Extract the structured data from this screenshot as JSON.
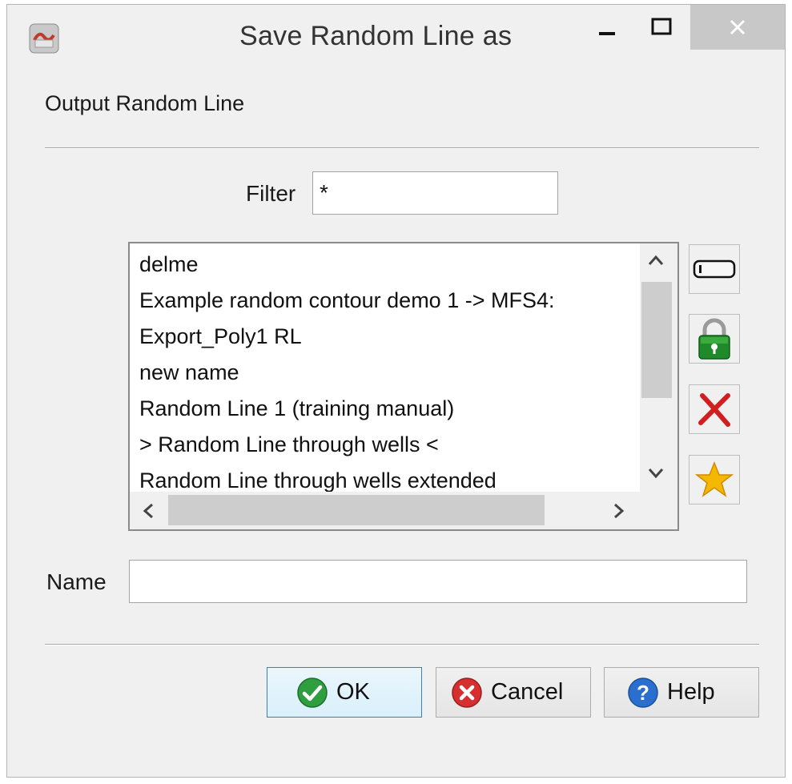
{
  "window": {
    "title": "Save Random Line as",
    "controls": [
      "minimize-icon",
      "maximize-icon",
      "close-icon"
    ]
  },
  "section_label": "Output Random Line",
  "filter": {
    "label": "Filter",
    "value": "*"
  },
  "list": {
    "items": [
      "delme",
      "Example random contour demo 1 -> MFS4:",
      "Export_Poly1 RL",
      "new name",
      "Random Line 1 (training manual)",
      "> Random Line through wells <",
      "Random Line through wells extended"
    ]
  },
  "side_icons": [
    "rename-icon",
    "lock-icon",
    "delete-icon",
    "star-icon"
  ],
  "name": {
    "label": "Name",
    "value": ""
  },
  "buttons": {
    "ok": "OK",
    "cancel": "Cancel",
    "help": "Help"
  },
  "colors": {
    "ok_accent": "#2e9e3e",
    "cancel_accent": "#d62f2f",
    "help_accent": "#2a6fcf",
    "lock_accent": "#1f8a2a"
  }
}
